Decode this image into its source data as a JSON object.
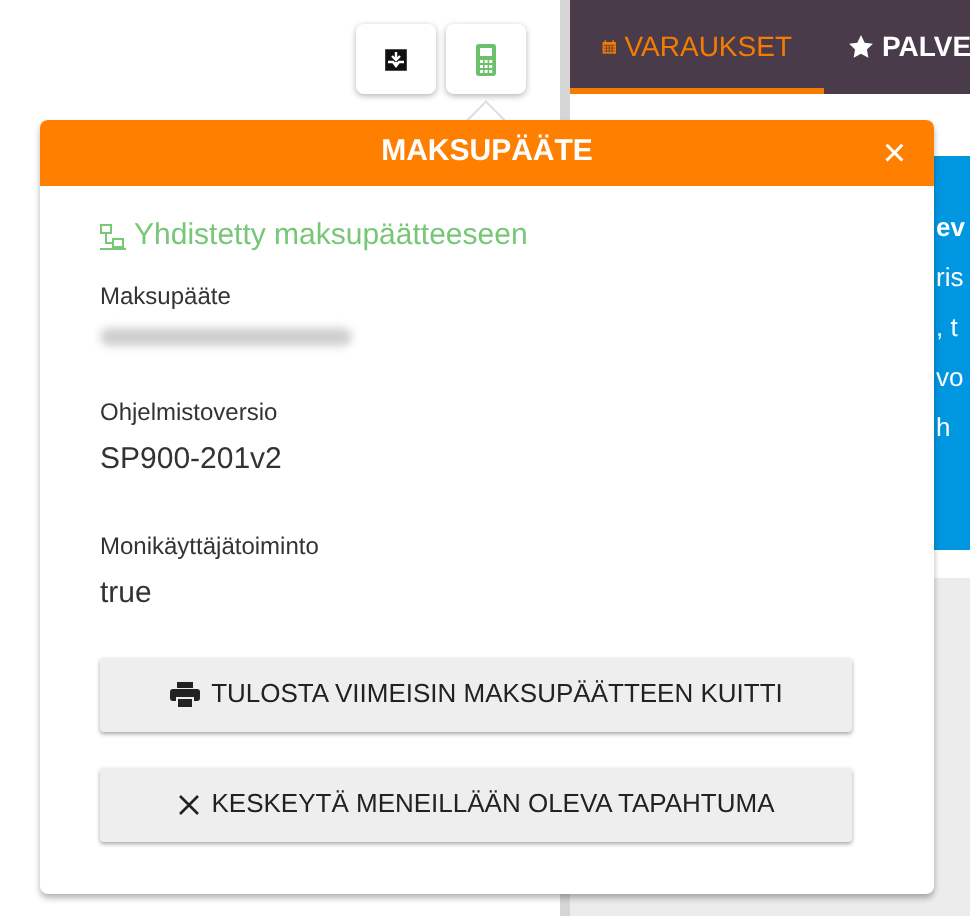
{
  "toolbar": {
    "buttons": [
      {
        "kind": "drawer"
      },
      {
        "kind": "terminal"
      }
    ]
  },
  "tabs": [
    {
      "label": "VARAUKSET",
      "kind": "calendar",
      "selected": true
    },
    {
      "label": "PALVE",
      "kind": "star",
      "selected": false
    }
  ],
  "notice": {
    "lines": [
      "ev",
      "ris",
      ", t",
      "vo",
      "h"
    ]
  },
  "dialog": {
    "title": "MAKSUPÄÄTE",
    "close": "×",
    "status": {
      "text": "Yhdistetty maksupäätteeseen",
      "connected": true
    },
    "fields": [
      {
        "label": "Maksupääte",
        "redacted": true
      },
      {
        "label": "Ohjelmistoversio",
        "value": "SP900-201v2"
      },
      {
        "label": "Monikäyttäjätoiminto",
        "value": "true"
      }
    ],
    "actions": [
      {
        "label": "TULOSTA VIIMEISIN MAKSUPÄÄTTEEN KUITTI",
        "kind": "printer"
      },
      {
        "label": "KESKEYTÄ MENEILLÄÄN OLEVA TAPAHTUMA",
        "kind": "cross"
      }
    ]
  }
}
